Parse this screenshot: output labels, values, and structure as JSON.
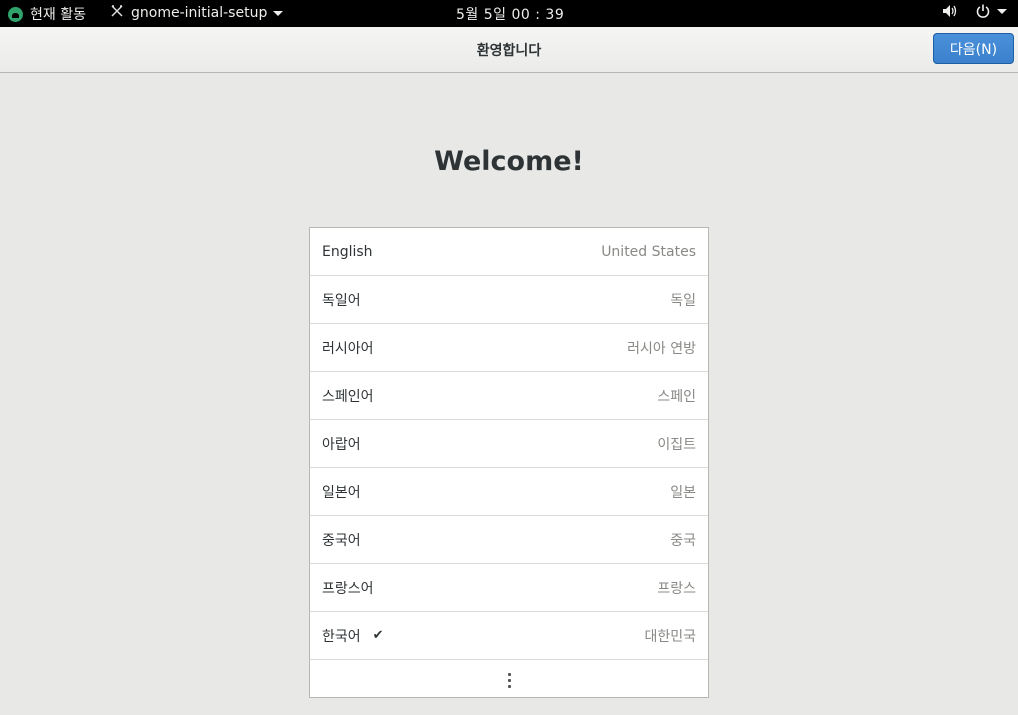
{
  "topbar": {
    "activities_label": "현재 활동",
    "app_name": "gnome-initial-setup",
    "clock": "5월 5일  00 : 39"
  },
  "header": {
    "title": "환영합니다",
    "next_label": "다음(N)"
  },
  "welcome_text": "Welcome!",
  "languages": [
    {
      "lang": "English",
      "country": "United States",
      "selected": false
    },
    {
      "lang": "독일어",
      "country": "독일",
      "selected": false
    },
    {
      "lang": "러시아어",
      "country": "러시아 연방",
      "selected": false
    },
    {
      "lang": "스페인어",
      "country": "스페인",
      "selected": false
    },
    {
      "lang": "아랍어",
      "country": "이집트",
      "selected": false
    },
    {
      "lang": "일본어",
      "country": "일본",
      "selected": false
    },
    {
      "lang": "중국어",
      "country": "중국",
      "selected": false
    },
    {
      "lang": "프랑스어",
      "country": "프랑스",
      "selected": false
    },
    {
      "lang": "한국어",
      "country": "대한민국",
      "selected": true
    }
  ],
  "check_mark": "✔",
  "icons": {
    "activities": "gnome-logo-icon",
    "app": "app-icon",
    "volume": "volume-icon",
    "power": "power-icon",
    "more": "more-vertical-icon"
  },
  "colors": {
    "accent": "#3a80cc",
    "background": "#e8e8e7"
  }
}
